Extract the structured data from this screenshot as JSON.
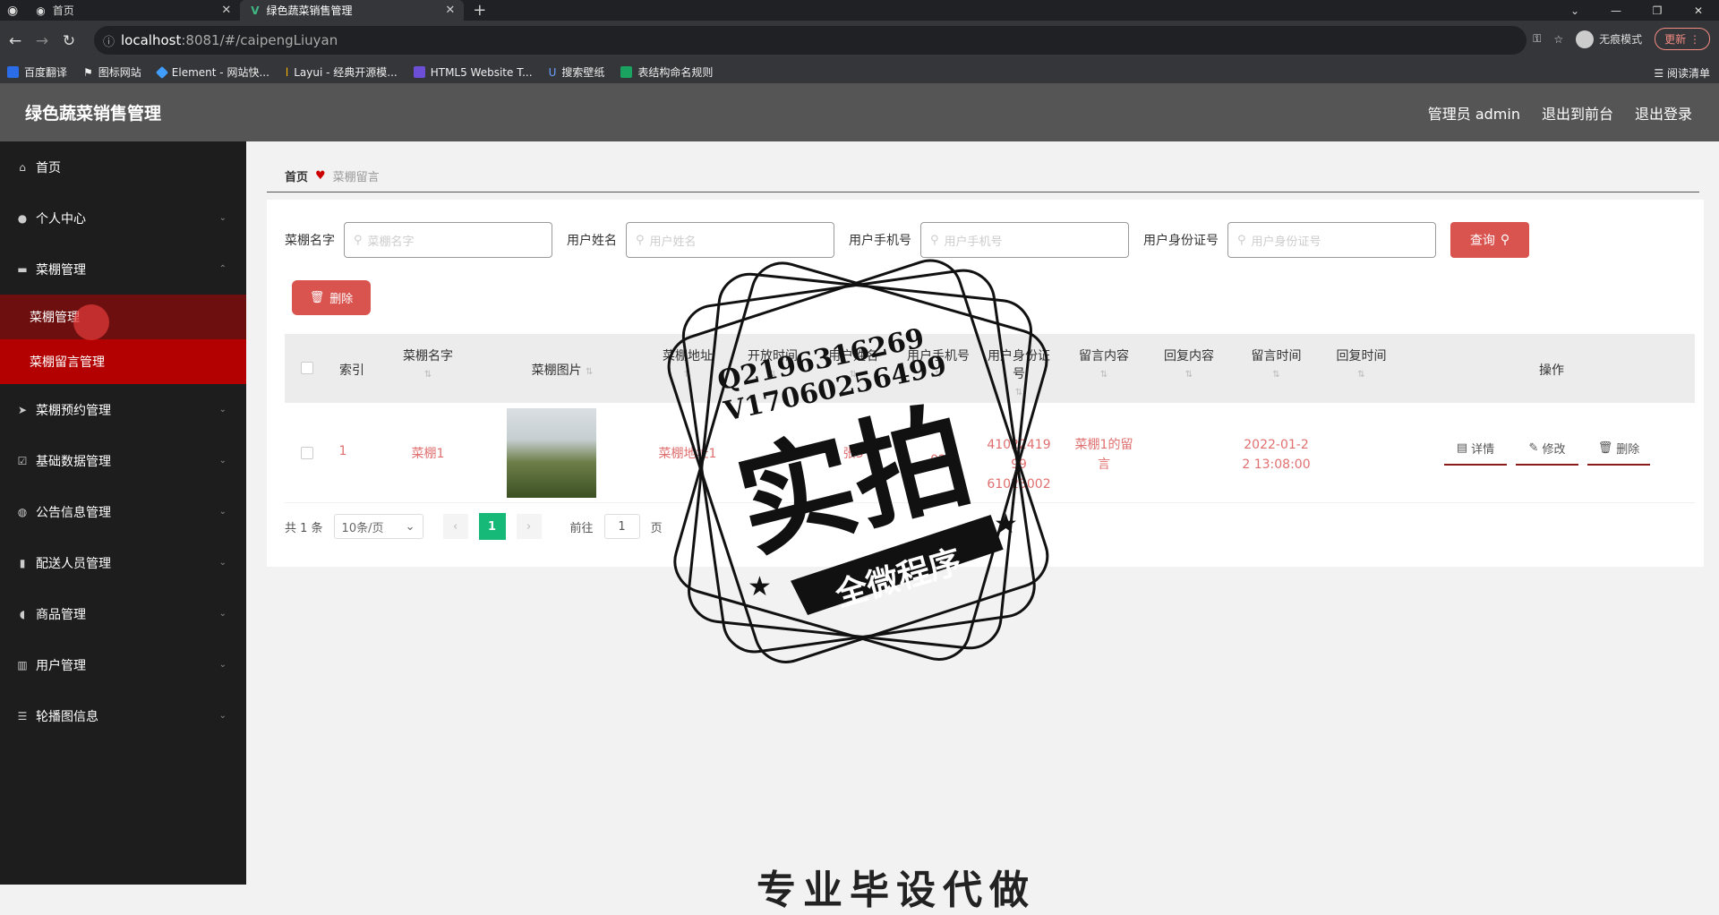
{
  "browser": {
    "tabs": [
      {
        "label": "首页",
        "active": false
      },
      {
        "label": "绿色蔬菜销售管理",
        "active": true
      }
    ],
    "url_host": "localhost",
    "url_rest": ":8081/#/caipengLiuyan",
    "incognito_label": "无痕模式",
    "update_label": "更新",
    "bookmarks": [
      {
        "label": "百度翻译",
        "color": "#2b6de8"
      },
      {
        "label": "图标网站",
        "color": "#ffffff"
      },
      {
        "label": "Element - 网站快...",
        "color": "#409eff"
      },
      {
        "label": "Layui - 经典开源模...",
        "color": "#ffb800"
      },
      {
        "label": "HTML5 Website T...",
        "color": "#6c4fd6"
      },
      {
        "label": "搜索壁纸",
        "color": "#2b6de8"
      },
      {
        "label": "表结构命名规则",
        "color": "#1aa260"
      }
    ],
    "reading_list": "阅读清单"
  },
  "header": {
    "brand": "绿色蔬菜销售管理",
    "admin": "管理员 admin",
    "front": "退出到前台",
    "logout": "退出登录"
  },
  "sidebar": {
    "items": [
      {
        "label": "首页",
        "icon": "home-icon",
        "chev": ""
      },
      {
        "label": "个人中心",
        "icon": "user-icon",
        "chev": "⌄"
      },
      {
        "label": "菜棚管理",
        "icon": "chat-icon",
        "chev": "⌃"
      },
      {
        "label": "菜棚预约管理",
        "icon": "send-icon",
        "chev": "⌄"
      },
      {
        "label": "基础数据管理",
        "icon": "check-icon",
        "chev": "⌄"
      },
      {
        "label": "公告信息管理",
        "icon": "globe-icon",
        "chev": "⌄"
      },
      {
        "label": "配送人员管理",
        "icon": "bar-icon",
        "chev": "⌄"
      },
      {
        "label": "商品管理",
        "icon": "leaf-icon",
        "chev": "⌄"
      },
      {
        "label": "用户管理",
        "icon": "building-icon",
        "chev": "⌄"
      },
      {
        "label": "轮播图信息",
        "icon": "sliders-icon",
        "chev": "⌄"
      }
    ],
    "subs": [
      "菜棚管理",
      "菜棚留言管理"
    ]
  },
  "breadcrumb": {
    "home": "首页",
    "current": "菜棚留言"
  },
  "filters": {
    "f1_label": "菜棚名字",
    "f1_ph": "菜棚名字",
    "f2_label": "用户姓名",
    "f2_ph": "用户姓名",
    "f3_label": "用户手机号",
    "f3_ph": "用户手机号",
    "f4_label": "用户身份证号",
    "f4_ph": "用户身份证号",
    "query": "查询"
  },
  "delete_label": "删除",
  "table": {
    "headers": [
      "索引",
      "菜棚名字",
      "菜棚图片",
      "菜棚地址",
      "开放时间",
      "用户姓名",
      "用户手机号",
      "用户身份证号",
      "留言内容",
      "回复内容",
      "留言时间",
      "回复时间",
      "操作"
    ],
    "row": {
      "index": "1",
      "name": "菜棚1",
      "address": "菜棚地址1",
      "user": "张3",
      "phone": "02",
      "idcard1": "41022419 99",
      "idcard2": "61023002",
      "msg1": "菜棚1的留",
      "msg2": "言",
      "time1": "2022-01-2",
      "time2": "2 13:08:00"
    },
    "ops": [
      "详情",
      "修改",
      "删除"
    ]
  },
  "pager": {
    "total": "共 1 条",
    "size": "10条/页",
    "current": "1",
    "goto": "前往",
    "goto_val": "1",
    "page": "页"
  },
  "watermark": {
    "line1": "Q2196316269",
    "line2": "V17060256499",
    "big": "实拍",
    "banner": "全微程序"
  },
  "bottom_text": "专业毕设代做"
}
